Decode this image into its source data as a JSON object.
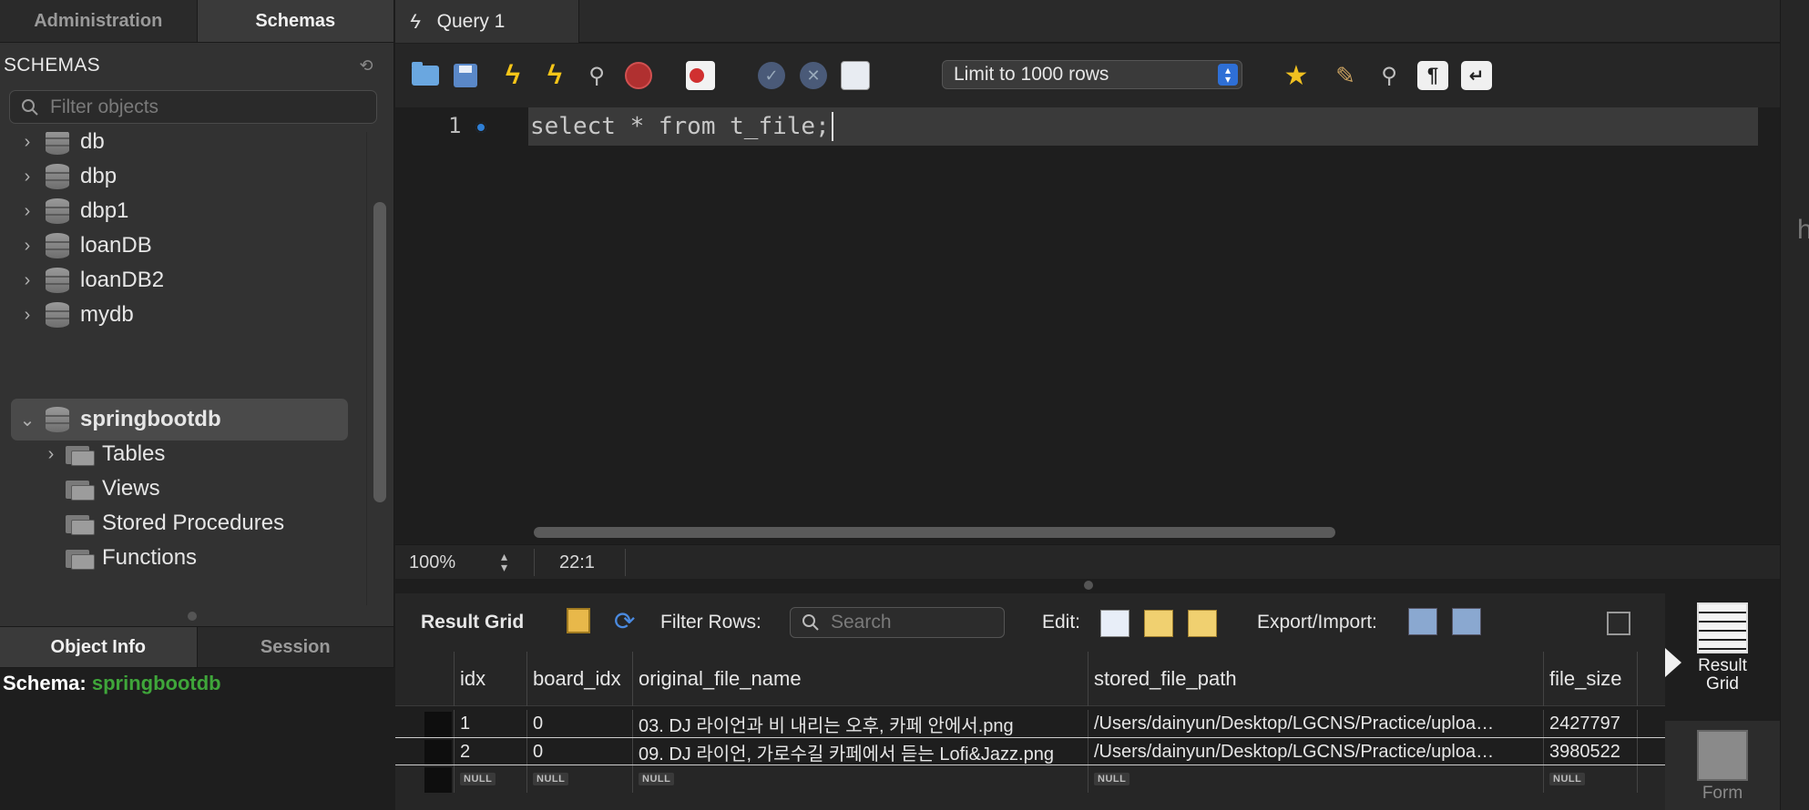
{
  "left_tabs": [
    "Administration",
    "Schemas"
  ],
  "schemas_panel": {
    "title": "SCHEMAS",
    "filter_placeholder": "Filter objects",
    "schemas": [
      "db",
      "dbp",
      "dbp1",
      "loanDB",
      "loanDB2",
      "mydb",
      "springbootdb"
    ],
    "selected_schema": "springbootdb",
    "children": [
      "Tables",
      "Views",
      "Stored Procedures",
      "Functions"
    ]
  },
  "bottom_tabs": [
    "Object Info",
    "Session"
  ],
  "object_info": {
    "label": "Schema:",
    "value": "springbootdb"
  },
  "query_tab": {
    "title": "Query 1"
  },
  "toolbar": {
    "limit_label": "Limit to 1000 rows"
  },
  "editor": {
    "line_number": "1",
    "code": "select * from t_file;"
  },
  "status": {
    "zoom": "100%",
    "position": "22:1"
  },
  "result_toolbar": {
    "title": "Result Grid",
    "filter_label": "Filter Rows:",
    "search_placeholder": "Search",
    "edit_label": "Edit:",
    "export_label": "Export/Import:"
  },
  "grid": {
    "columns": [
      "idx",
      "board_idx",
      "original_file_name",
      "stored_file_path",
      "file_size"
    ],
    "rows": [
      [
        "1",
        "0",
        "03. DJ 라이언과 비 내리는 오후, 카페 안에서.png",
        "/Users/dainyun/Desktop/LGCNS/Practice/uploa…",
        "2427797"
      ],
      [
        "2",
        "0",
        "09. DJ 라이언, 가로수길 카페에서 듣는 Lofi&Jazz.png",
        "/Users/dainyun/Desktop/LGCNS/Practice/uploa…",
        "3980522"
      ],
      [
        "NULL",
        "NULL",
        "NULL",
        "NULL",
        "NULL"
      ]
    ]
  },
  "side_panel": {
    "result_grid_label_1": "Result",
    "result_grid_label_2": "Grid",
    "form_label": "Form"
  },
  "far_right_glyph": "h"
}
